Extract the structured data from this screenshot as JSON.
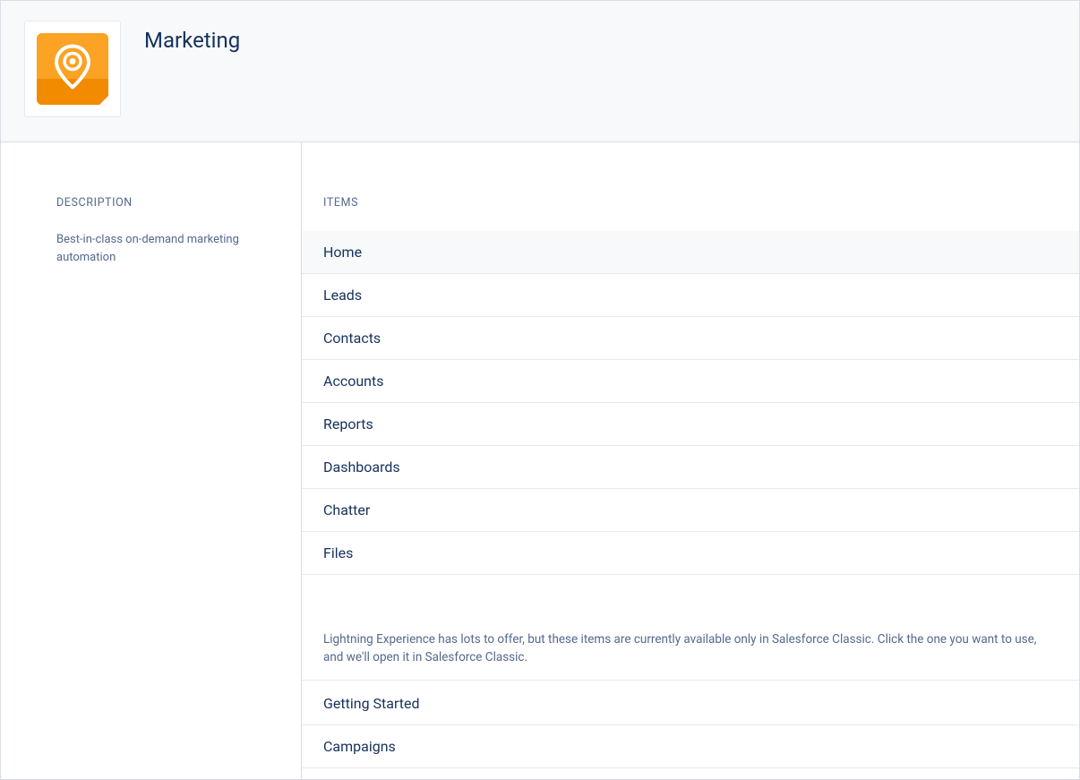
{
  "header": {
    "title": "Marketing"
  },
  "sidebar": {
    "heading": "DESCRIPTION",
    "description": "Best-in-class on-demand marketing automation"
  },
  "main": {
    "items_heading": "ITEMS",
    "items": [
      {
        "label": "Home"
      },
      {
        "label": "Leads"
      },
      {
        "label": "Contacts"
      },
      {
        "label": "Accounts"
      },
      {
        "label": "Reports"
      },
      {
        "label": "Dashboards"
      },
      {
        "label": "Chatter"
      },
      {
        "label": "Files"
      }
    ],
    "classic_note": "Lightning Experience has lots to offer, but these items are currently available only in Salesforce Classic. Click the one you want to use, and we'll open it in Salesforce Classic.",
    "classic_items": [
      {
        "label": "Getting Started"
      },
      {
        "label": "Campaigns"
      }
    ]
  }
}
